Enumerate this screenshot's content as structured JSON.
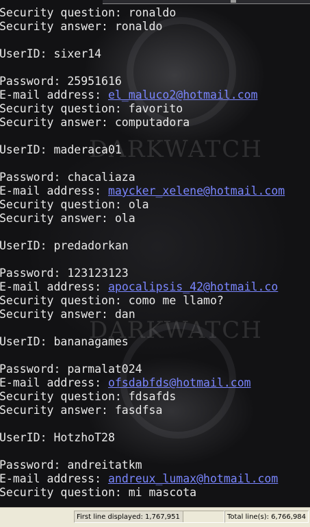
{
  "lines": [
    {
      "text": "Security question: ronaldo"
    },
    {
      "text": "Security answer: ronaldo"
    },
    {
      "text": ""
    },
    {
      "text": "UserID: sixer14"
    },
    {
      "text": ""
    },
    {
      "text": "Password: 25951616"
    },
    {
      "prefix": "E-mail address: ",
      "link": "el_maluco2@hotmail.com"
    },
    {
      "text": "Security question: favorito"
    },
    {
      "text": "Security answer: computadora"
    },
    {
      "text": ""
    },
    {
      "text": "UserID: maderaca01"
    },
    {
      "text": ""
    },
    {
      "text": "Password: chacaliaza"
    },
    {
      "prefix": "E-mail address: ",
      "link": "maycker_xelene@hotmail.com"
    },
    {
      "text": "Security question: ola"
    },
    {
      "text": "Security answer: ola"
    },
    {
      "text": ""
    },
    {
      "text": "UserID: predadorkan"
    },
    {
      "text": ""
    },
    {
      "text": "Password: 123123123"
    },
    {
      "prefix": "E-mail address: ",
      "link": "apocalipsis_42@hotmail.co"
    },
    {
      "text": "Security question: como me llamo?"
    },
    {
      "text": "Security answer: dan"
    },
    {
      "text": ""
    },
    {
      "text": "UserID: bananagames"
    },
    {
      "text": ""
    },
    {
      "text": "Password: parmalat024"
    },
    {
      "prefix": "E-mail address: ",
      "link": "ofsdabfds@hotmail.com"
    },
    {
      "text": "Security question: fdsafds"
    },
    {
      "text": "Security answer: fasdfsa"
    },
    {
      "text": ""
    },
    {
      "text": "UserID: HotzhoT28"
    },
    {
      "text": ""
    },
    {
      "text": "Password: andreitatkm"
    },
    {
      "prefix": "E-mail address: ",
      "link": "andreux_lumax@hotmail.com"
    },
    {
      "text": "Security question: mi mascota"
    }
  ],
  "watermark_text": "DARKWATCH",
  "status": {
    "first_line": "First line displayed: 1,767,951",
    "total_lines": "Total line(s): 6,766,984"
  },
  "colors": {
    "background": "#121214",
    "text": "#eaeaea",
    "link": "#7a86ff",
    "statusbar": "#ece9d8"
  }
}
